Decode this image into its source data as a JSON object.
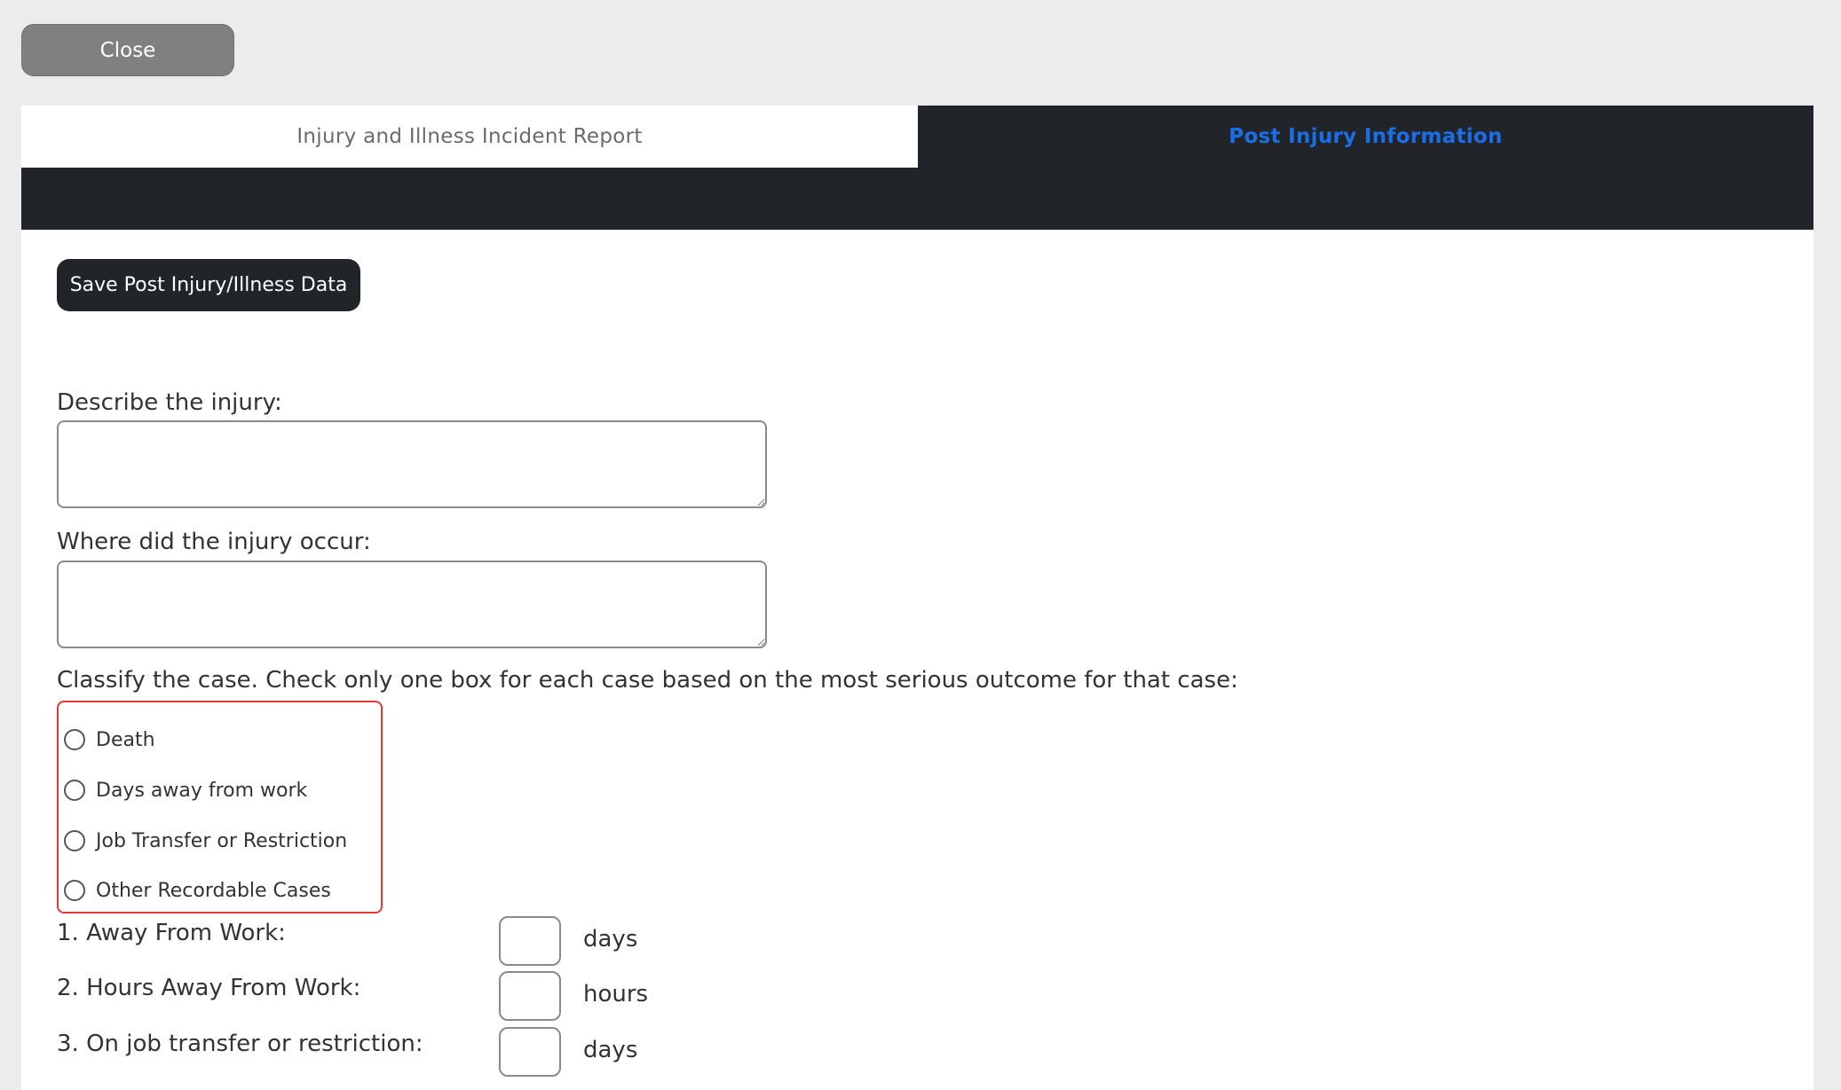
{
  "top": {
    "close_label": "Close"
  },
  "tabs": [
    {
      "label": "Injury and Illness Incident Report",
      "active": false
    },
    {
      "label": "Post Injury Information",
      "active": true
    }
  ],
  "form": {
    "save_label": "Save Post Injury/Illness Data",
    "describe_label": "Describe the injury:",
    "describe_value": "",
    "where_label": "Where did the injury occur:",
    "where_value": "",
    "classify_label": "Classify the case. Check only one box for each case based on the most serious outcome for that case:",
    "classify_options": [
      "Death",
      "Days away from work",
      "Job Transfer or Restriction",
      "Other Recordable Cases"
    ],
    "fields": [
      {
        "label": "1. Away From Work:",
        "value": "",
        "unit": "days"
      },
      {
        "label": "2. Hours Away From Work:",
        "value": "",
        "unit": "hours"
      },
      {
        "label": "3. On job transfer or restriction:",
        "value": "",
        "unit": "days"
      }
    ]
  },
  "colors": {
    "active_tab_text": "#1a6fe8",
    "tab_bar": "#212529",
    "radio_group_border": "#e53935",
    "close_button": "#808080"
  }
}
